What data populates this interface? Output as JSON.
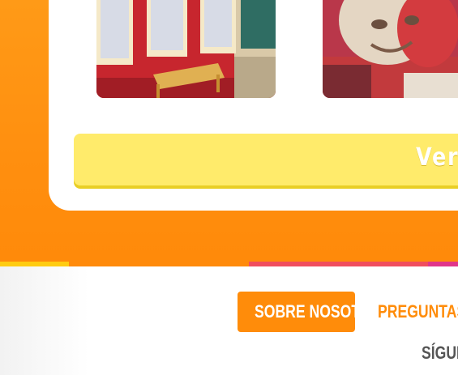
{
  "gallery": {
    "cta_label": "Ver",
    "photos": [
      {
        "name": "theater-lobby-bench"
      },
      {
        "name": "theater-masks"
      }
    ]
  },
  "footer": {
    "nav": [
      {
        "label": "SOBRE NOSOTROS",
        "active": true
      },
      {
        "label": "PREGUNTAS F"
      }
    ],
    "follow_label": "SÍGUE"
  },
  "colors": {
    "hero_orange": "#ff8f0f",
    "cta_yellow": "#ffeb6b",
    "nav_orange": "#ff8c0a",
    "stripe_yellow": "#ffcc11",
    "stripe_red": "#f04e5e",
    "stripe_pink": "#e0368a"
  }
}
